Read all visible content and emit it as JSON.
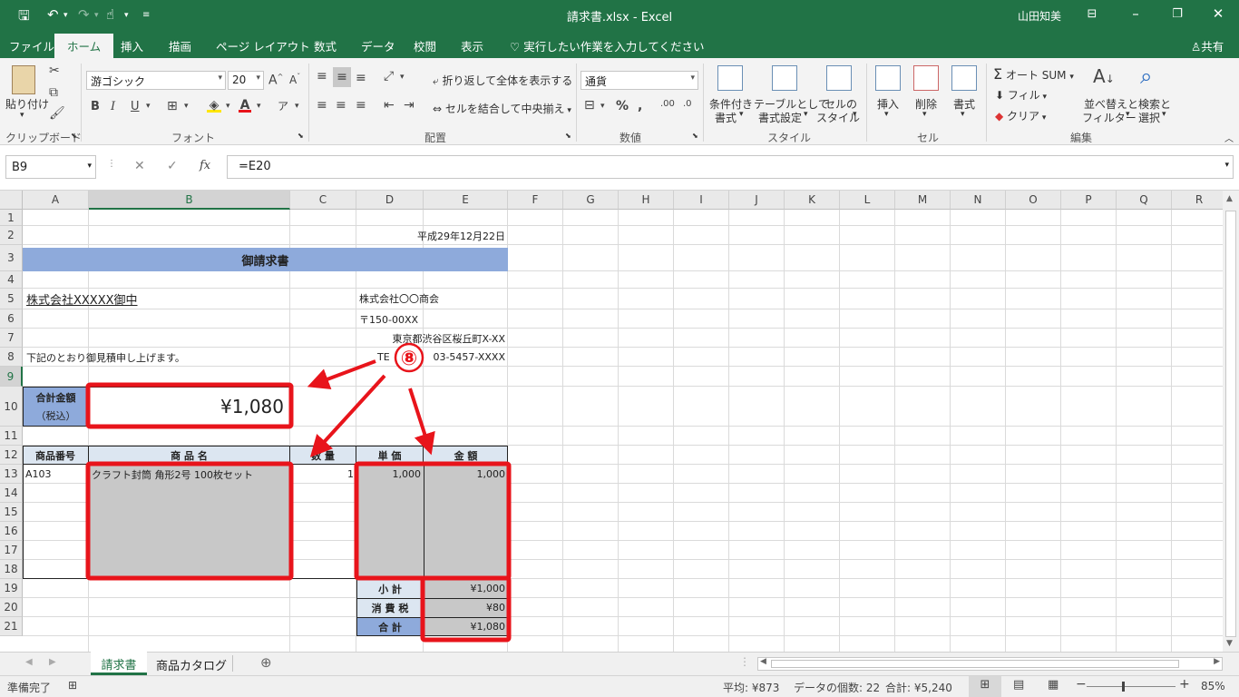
{
  "window": {
    "title": "請求書.xlsx - Excel",
    "user": "山田知美"
  },
  "ribbon_tabs": [
    "ファイル",
    "ホーム",
    "挿入",
    "描画",
    "ページ レイアウト",
    "数式",
    "データ",
    "校閲",
    "表示"
  ],
  "tell_me": "実行したい作業を入力してください",
  "share": "共有",
  "clipboard": {
    "paste": "貼り付け",
    "group": "クリップボード"
  },
  "font": {
    "name": "游ゴシック",
    "size": "20",
    "group": "フォント"
  },
  "alignment": {
    "wrap": "折り返して全体を表示する",
    "merge": "セルを結合して中央揃え",
    "group": "配置"
  },
  "number": {
    "format": "通貨",
    "group": "数値"
  },
  "styles": {
    "cond_format": "条件付き書式",
    "table_format": "テーブルとして書式設定",
    "cell_style": "セルのスタイル",
    "cond_format_l1": "条件付き",
    "cond_format_l2": "書式",
    "table_l1": "テーブルとして",
    "table_l2": "書式設定",
    "cellstyle_l1": "セルの",
    "cellstyle_l2": "スタイル",
    "group": "スタイル"
  },
  "cells": {
    "insert": "挿入",
    "delete": "削除",
    "format": "書式",
    "group": "セル"
  },
  "editing": {
    "autosum": "オート SUM",
    "fill": "フィル",
    "clear": "クリア",
    "sort_l1": "並べ替えと",
    "sort_l2": "フィルター",
    "find_l1": "検索と",
    "find_l2": "選択",
    "group": "編集"
  },
  "formula_bar": {
    "name_box": "B9",
    "formula": "=E20"
  },
  "columns": [
    "A",
    "B",
    "C",
    "D",
    "E",
    "F",
    "G",
    "H",
    "I",
    "J",
    "K",
    "L",
    "M",
    "N",
    "O",
    "P",
    "Q",
    "R"
  ],
  "rows": [
    "1",
    "2",
    "3",
    "4",
    "5",
    "6",
    "7",
    "8",
    "9",
    "10",
    "11",
    "12",
    "13",
    "14",
    "15",
    "16",
    "17",
    "18",
    "19",
    "20",
    "21"
  ],
  "sheet": {
    "date": "平成29年12月22日",
    "title": "御請求書",
    "customer": "株式会社XXXXX御中",
    "company": "株式会社〇〇商会",
    "zip": "〒150-00XX",
    "address": "東京都渋谷区桜丘町X-XX",
    "tel_prefix": "TE",
    "tel_number": "03-5457-XXXX",
    "greeting": "下記のとおり御見積申し上げます。",
    "total_label_1": "合計金額",
    "total_label_2": "（税込）",
    "total_value": "¥1,080",
    "headers": {
      "code": "商品番号",
      "name": "商 品 名",
      "qty": "数 量",
      "price": "単 価",
      "amount": "金 額"
    },
    "item": {
      "code": "A103",
      "name": "クラフト封筒 角形2号 100枚セット",
      "qty": "1",
      "price": "1,000",
      "amount": "1,000"
    },
    "subtotal_label": "小 計",
    "subtotal": "¥1,000",
    "tax_label": "消 費 税",
    "tax": "¥80",
    "grand_label": "合 計",
    "grand_total": "¥1,080"
  },
  "annotation": {
    "step": "⑧",
    "color": "#e8141b"
  },
  "sheet_tabs": [
    "請求書",
    "商品カタログ"
  ],
  "status": {
    "ready": "準備完了",
    "average": "平均: ¥873",
    "count": "データの個数: 22",
    "sum": "合計: ¥5,240",
    "zoom": "85%"
  },
  "colors": {
    "excel_green": "#217346",
    "header_blue": "#8eaadb",
    "table_head": "#dce6f1",
    "gray_fill": "#c8c8c8"
  }
}
